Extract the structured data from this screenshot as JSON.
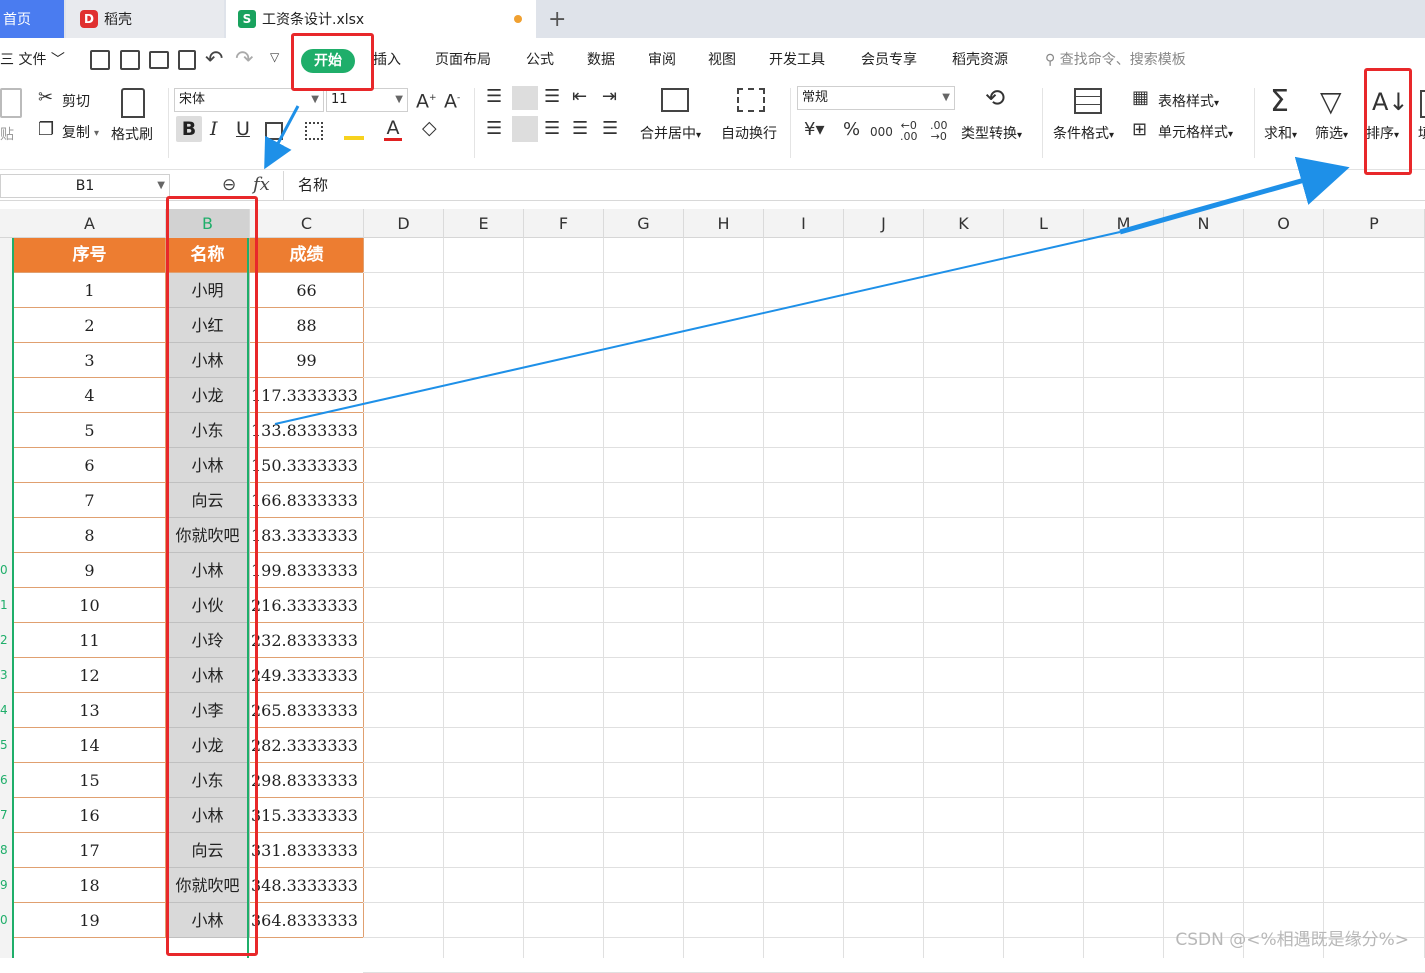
{
  "tabs": {
    "home": "首页",
    "daoke": "稻壳",
    "file": "工资条设计.xlsx",
    "add": "+"
  },
  "menu": {
    "file": "三 文件 ﹀",
    "start": "开始",
    "items": [
      "插入",
      "页面布局",
      "公式",
      "数据",
      "审阅",
      "视图",
      "开发工具",
      "会员专享",
      "稻壳资源"
    ],
    "search": "查找命令、搜索模板"
  },
  "ribbon": {
    "paste": "贴",
    "cut": "剪切",
    "copy": "复制",
    "format_painter": "格式刷",
    "font_name": "宋体",
    "font_size": "11",
    "merge_center": "合并居中",
    "wrap_text": "自动换行",
    "number_format": "常规",
    "type_convert": "类型转换",
    "conditional_format": "条件格式",
    "table_style": "表格样式",
    "cell_style": "单元格样式",
    "sum": "求和",
    "filter": "筛选",
    "sort": "排序",
    "fill_partial": "填"
  },
  "formula_bar": {
    "name_box": "B1",
    "fx": "fx",
    "value": "名称"
  },
  "columns": [
    "A",
    "B",
    "C",
    "D",
    "E",
    "F",
    "G",
    "H",
    "I",
    "J",
    "K",
    "L",
    "M",
    "N",
    "O",
    "P"
  ],
  "row_numbers_partial": [
    "0",
    "1",
    "2",
    "3",
    "4",
    "5",
    "6",
    "7",
    "8",
    "9",
    "0"
  ],
  "table": {
    "headers": [
      "序号",
      "名称",
      "成绩"
    ],
    "rows": [
      [
        "1",
        "小明",
        "66"
      ],
      [
        "2",
        "小红",
        "88"
      ],
      [
        "3",
        "小林",
        "99"
      ],
      [
        "4",
        "小龙",
        "117.3333333"
      ],
      [
        "5",
        "小东",
        "133.8333333"
      ],
      [
        "6",
        "小林",
        "150.3333333"
      ],
      [
        "7",
        "向云",
        "166.8333333"
      ],
      [
        "8",
        "你就吹吧",
        "183.3333333"
      ],
      [
        "9",
        "小林",
        "199.8333333"
      ],
      [
        "10",
        "小伙",
        "216.3333333"
      ],
      [
        "11",
        "小玲",
        "232.8333333"
      ],
      [
        "12",
        "小林",
        "249.3333333"
      ],
      [
        "13",
        "小李",
        "265.8333333"
      ],
      [
        "14",
        "小龙",
        "282.3333333"
      ],
      [
        "15",
        "小东",
        "298.8333333"
      ],
      [
        "16",
        "小林",
        "315.3333333"
      ],
      [
        "17",
        "向云",
        "331.8333333"
      ],
      [
        "18",
        "你就吹吧",
        "348.3333333"
      ],
      [
        "19",
        "小林",
        "364.8333333"
      ]
    ]
  },
  "watermark": "CSDN @<%相遇既是缘分%>",
  "colors": {
    "accent_green": "#1fae6a",
    "header_orange": "#ed7d31",
    "annotation_red": "#e8282a",
    "annotation_blue": "#1e90e8"
  }
}
